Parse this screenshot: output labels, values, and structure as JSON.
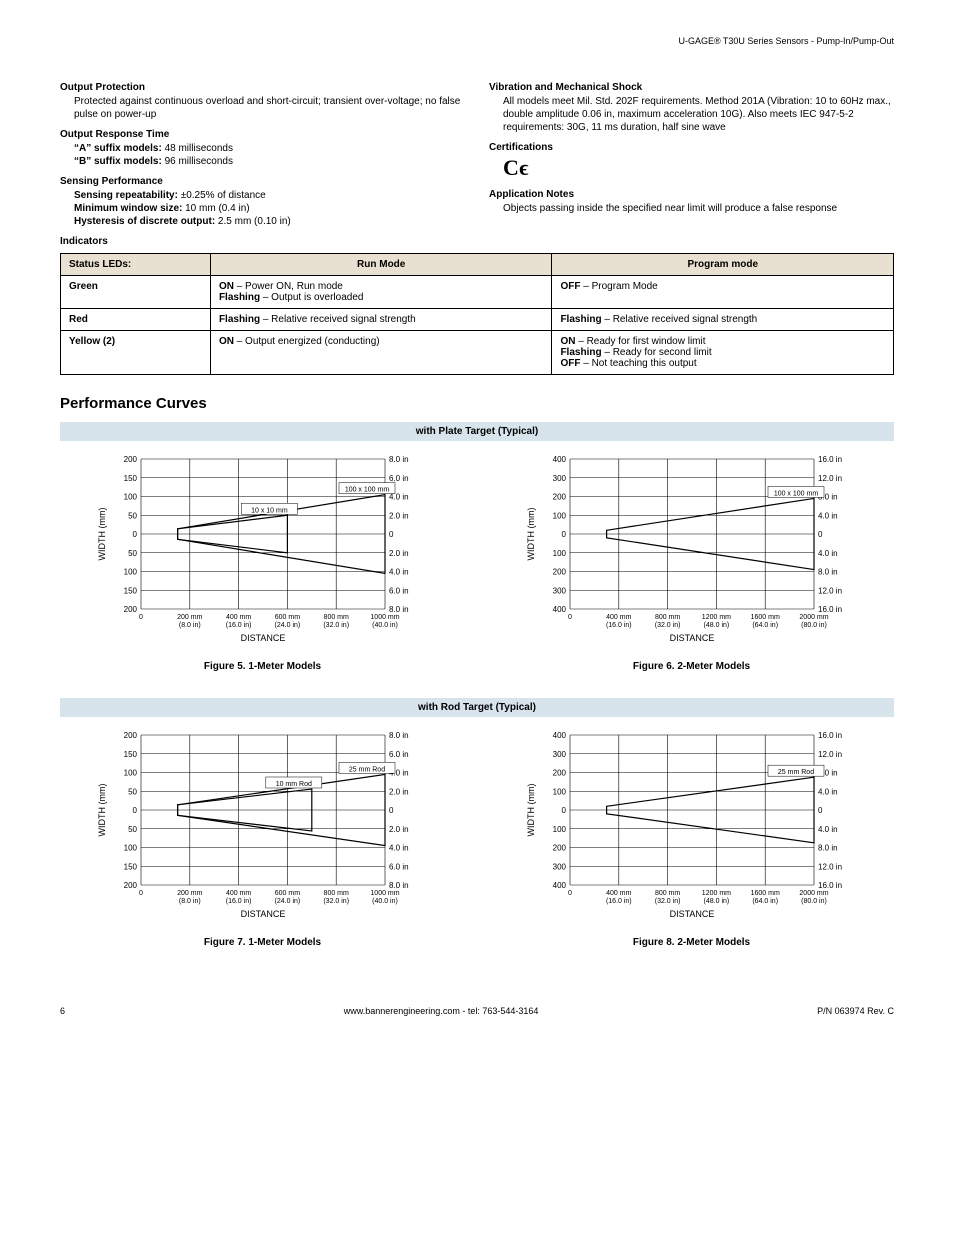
{
  "header": {
    "product": "U-GAGE® T30U Series Sensors - Pump-In/Pump-Out"
  },
  "specs_left": {
    "output_protection": {
      "title": "Output Protection",
      "body": "Protected against continuous overload and short-circuit; transient over-voltage; no false pulse on power-up"
    },
    "output_response": {
      "title": "Output Response Time",
      "a_label": "“A” suffix models:",
      "a_val": " 48 milliseconds",
      "b_label": "“B” suffix models:",
      "b_val": " 96 milliseconds"
    },
    "sensing_perf": {
      "title": "Sensing Performance",
      "r_label": "Sensing repeatability:",
      "r_val": " ±0.25% of distance",
      "m_label": "Minimum window size:",
      "m_val": " 10 mm (0.4 in)",
      "h_label": "Hysteresis of discrete output:",
      "h_val": " 2.5 mm (0.10 in)"
    },
    "indicators_label": "Indicators"
  },
  "specs_right": {
    "vibration": {
      "title": "Vibration and Mechanical Shock",
      "body": "All models meet Mil. Std. 202F requirements. Method 201A (Vibration: 10 to 60Hz max., double amplitude 0.06 in, maximum acceleration 10G). Also meets IEC 947-5-2 requirements: 30G, 11 ms duration, half sine wave"
    },
    "certifications": {
      "title": "Certifications",
      "mark": "C ϵ"
    },
    "app_notes": {
      "title": "Application Notes",
      "body": "Objects passing inside the specified near limit will produce a false response"
    }
  },
  "table": {
    "headers": [
      "Status LEDs:",
      "Run Mode",
      "Program mode"
    ],
    "rows": [
      {
        "led": "Green",
        "run_parts": [
          "ON",
          " – Power ON, Run mode",
          "Flashing",
          " – Output is overloaded"
        ],
        "prog_parts": [
          "OFF",
          " – Program Mode"
        ]
      },
      {
        "led": "Red",
        "run_parts": [
          "Flashing",
          " – Relative received signal strength"
        ],
        "prog_parts": [
          "Flashing",
          " – Relative received signal strength"
        ]
      },
      {
        "led": "Yellow (2)",
        "run_parts": [
          "ON",
          " – Output energized (conducting)"
        ],
        "prog_parts": [
          "ON",
          " – Ready for first window limit",
          "Flashing",
          " – Ready for second limit",
          "OFF",
          " – Not teaching this output"
        ]
      }
    ]
  },
  "curves": {
    "section_title": "Performance Curves",
    "bar1": "with Plate Target (Typical)",
    "bar2": "with Rod Target (Typical)",
    "cap5": "Figure 5. 1-Meter Models",
    "cap6": "Figure 6. 2-Meter Models",
    "cap7": "Figure 7. 1-Meter Models",
    "cap8": "Figure 8. 2-Meter Models"
  },
  "footer": {
    "page": "6",
    "mid": "www.bannerengineering.com - tel: 763-544-3164",
    "right": "P/N 063974 Rev. C"
  },
  "chart_data": [
    {
      "id": "fig5",
      "type": "line",
      "title": "Figure 5. 1-Meter Models (Plate Target)",
      "xlabel": "DISTANCE",
      "ylabel": "WIDTH (mm)",
      "y_ticks_mm": [
        200,
        150,
        100,
        50,
        0,
        50,
        100,
        150,
        200
      ],
      "y_ticks_in": [
        "8.0 in",
        "6.0 in",
        "4.0 in",
        "2.0 in",
        "0",
        "2.0 in",
        "4.0 in",
        "6.0 in",
        "8.0 in"
      ],
      "x_ticks": [
        {
          "mm": "0",
          "in": ""
        },
        {
          "mm": "200 mm",
          "in": "(8.0 in)"
        },
        {
          "mm": "400 mm",
          "in": "(16.0 in)"
        },
        {
          "mm": "600 mm",
          "in": "(24.0 in)"
        },
        {
          "mm": "800 mm",
          "in": "(32.0 in)"
        },
        {
          "mm": "1000 mm",
          "in": "(40.0 in)"
        }
      ],
      "series": [
        {
          "name": "100 x 100 mm",
          "x": [
            150,
            1000
          ],
          "y_half": [
            14,
            105
          ]
        },
        {
          "name": "10 x 10 mm",
          "x": [
            150,
            600
          ],
          "y_half": [
            14,
            50
          ]
        }
      ]
    },
    {
      "id": "fig6",
      "type": "line",
      "title": "Figure 6. 2-Meter Models (Plate Target)",
      "xlabel": "DISTANCE",
      "ylabel": "WIDTH (mm)",
      "y_ticks_mm": [
        400,
        300,
        200,
        100,
        0,
        100,
        200,
        300,
        400
      ],
      "y_ticks_in": [
        "16.0 in",
        "12.0 in",
        "8.0 in",
        "4.0 in",
        "0",
        "4.0 in",
        "8.0 in",
        "12.0 in",
        "16.0 in"
      ],
      "x_ticks": [
        {
          "mm": "0",
          "in": ""
        },
        {
          "mm": "400 mm",
          "in": "(16.0 in)"
        },
        {
          "mm": "800 mm",
          "in": "(32.0 in)"
        },
        {
          "mm": "1200 mm",
          "in": "(48.0 in)"
        },
        {
          "mm": "1600 mm",
          "in": "(64.0 in)"
        },
        {
          "mm": "2000 mm",
          "in": "(80.0 in)"
        }
      ],
      "series": [
        {
          "name": "100 x 100 mm",
          "x": [
            300,
            2000
          ],
          "y_half": [
            20,
            190
          ]
        }
      ]
    },
    {
      "id": "fig7",
      "type": "line",
      "title": "Figure 7. 1-Meter Models (Rod Target)",
      "xlabel": "DISTANCE",
      "ylabel": "WIDTH (mm)",
      "y_ticks_mm": [
        200,
        150,
        100,
        50,
        0,
        50,
        100,
        150,
        200
      ],
      "y_ticks_in": [
        "8.0 in",
        "6.0 in",
        "4.0 in",
        "2.0 in",
        "0",
        "2.0 in",
        "4.0 in",
        "6.0 in",
        "8.0 in"
      ],
      "x_ticks": [
        {
          "mm": "0",
          "in": ""
        },
        {
          "mm": "200 mm",
          "in": "(8.0 in)"
        },
        {
          "mm": "400 mm",
          "in": "(16.0 in)"
        },
        {
          "mm": "600 mm",
          "in": "(24.0 in)"
        },
        {
          "mm": "800 mm",
          "in": "(32.0 in)"
        },
        {
          "mm": "1000 mm",
          "in": "(40.0 in)"
        }
      ],
      "series": [
        {
          "name": "25 mm Rod",
          "x": [
            150,
            1000
          ],
          "y_half": [
            14,
            95
          ]
        },
        {
          "name": "10 mm Rod",
          "x": [
            150,
            700
          ],
          "y_half": [
            14,
            56
          ]
        }
      ]
    },
    {
      "id": "fig8",
      "type": "line",
      "title": "Figure 8. 2-Meter Models (Rod Target)",
      "xlabel": "DISTANCE",
      "ylabel": "WIDTH (mm)",
      "y_ticks_mm": [
        400,
        300,
        200,
        100,
        0,
        100,
        200,
        300,
        400
      ],
      "y_ticks_in": [
        "16.0 in",
        "12.0 in",
        "8.0 in",
        "4.0 in",
        "0",
        "4.0 in",
        "8.0 in",
        "12.0 in",
        "16.0 in"
      ],
      "x_ticks": [
        {
          "mm": "0",
          "in": ""
        },
        {
          "mm": "400 mm",
          "in": "(16.0 in)"
        },
        {
          "mm": "800 mm",
          "in": "(32.0 in)"
        },
        {
          "mm": "1200 mm",
          "in": "(48.0 in)"
        },
        {
          "mm": "1600 mm",
          "in": "(64.0 in)"
        },
        {
          "mm": "2000 mm",
          "in": "(80.0 in)"
        }
      ],
      "series": [
        {
          "name": "25 mm Rod",
          "x": [
            300,
            2000
          ],
          "y_half": [
            20,
            175
          ]
        }
      ]
    }
  ]
}
